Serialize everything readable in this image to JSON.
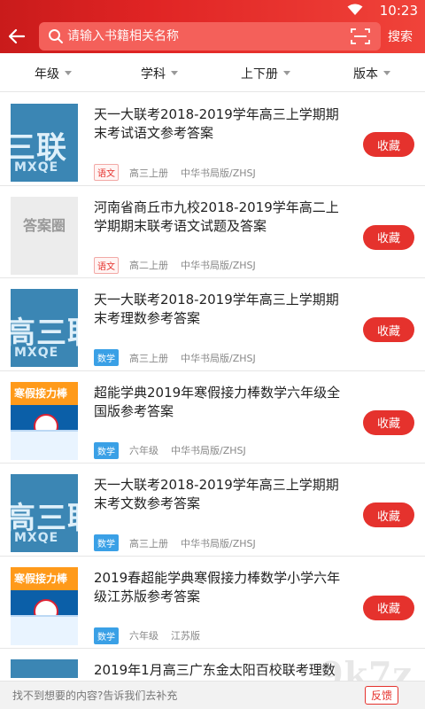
{
  "status": {
    "time": "10:23"
  },
  "header": {
    "search_placeholder": "请输入书籍相关名称",
    "search_button": "搜索"
  },
  "filters": [
    {
      "label": "年级"
    },
    {
      "label": "学科"
    },
    {
      "label": "上下册"
    },
    {
      "label": "版本"
    }
  ],
  "items": [
    {
      "title": "天一大联考2018-2019学年高三上学期期末考试语文参考答案",
      "subject": "语文",
      "grade": "高三上册",
      "edition": "中华书局版/ZHSJ",
      "cover_text": "三联",
      "cover_sub": "MXQE",
      "fav": "收藏"
    },
    {
      "title": "河南省商丘市九校2018-2019学年高二上学期期末联考语文试题及答案",
      "subject": "语文",
      "grade": "高二上册",
      "edition": "中华书局版/ZHSJ",
      "cover_text": "答案圈",
      "fav": "收藏"
    },
    {
      "title": "天一大联考2018-2019学年高三上学期期末考理数参考答案",
      "subject": "数学",
      "grade": "高三上册",
      "edition": "中华书局版/ZHSJ",
      "cover_text": "高三联考",
      "cover_sub": "MXQE",
      "fav": "收藏"
    },
    {
      "title": "超能学典2019年寒假接力棒数学六年级全国版参考答案",
      "subject": "数学",
      "grade": "六年级",
      "edition": "中华书局版/ZHSJ",
      "cover_text": "寒假接力棒",
      "fav": "收藏"
    },
    {
      "title": "天一大联考2018-2019学年高三上学期期末考文数参考答案",
      "subject": "数学",
      "grade": "高三上册",
      "edition": "中华书局版/ZHSJ",
      "cover_text": "高三联考",
      "cover_sub": "MXQE",
      "fav": "收藏"
    },
    {
      "title": "2019春超能学典寒假接力棒数学小学六年级江苏版参考答案",
      "subject": "数学",
      "grade": "六年级",
      "edition": "江苏版",
      "cover_text": "寒假接力棒",
      "fav": "收藏"
    },
    {
      "title": "2019年1月高三广东金太阳百校联考理数"
    }
  ],
  "bottom": {
    "tip": "找不到想要的内容?告诉我们去补充",
    "feedback": "反馈"
  },
  "watermark": "9k7z"
}
